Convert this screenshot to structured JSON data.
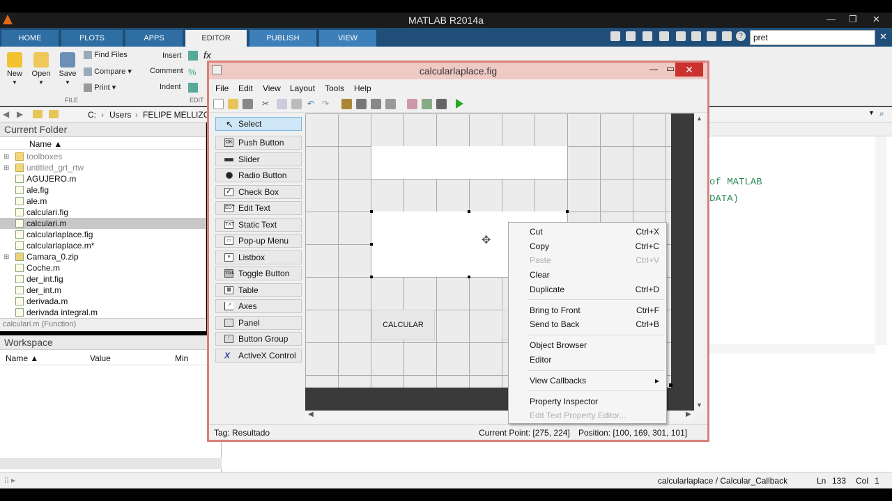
{
  "window": {
    "title": "MATLAB R2014a"
  },
  "ribbon_tabs": [
    {
      "label": "HOME"
    },
    {
      "label": "PLOTS"
    },
    {
      "label": "APPS"
    },
    {
      "label": "EDITOR"
    },
    {
      "label": "PUBLISH"
    },
    {
      "label": "VIEW"
    }
  ],
  "search": {
    "value": "pret"
  },
  "ribbon": {
    "new": "New",
    "open": "Open",
    "save": "Save",
    "find_files": "Find Files",
    "compare": "Compare",
    "print": "Print",
    "insert": "Insert",
    "comment": "Comment",
    "indent": "Indent",
    "file_group": "FILE",
    "edit_group": "EDIT"
  },
  "address": {
    "parts": [
      "C:",
      "Users",
      "FELIPE MELLIZO"
    ]
  },
  "current_folder": {
    "title": "Current Folder",
    "column": "Name",
    "items": [
      {
        "name": "toolboxes",
        "type": "folder"
      },
      {
        "name": "untitled_grt_rtw",
        "type": "folder"
      },
      {
        "name": "AGUJERO.m",
        "type": "m"
      },
      {
        "name": "ale.fig",
        "type": "fig"
      },
      {
        "name": "ale.m",
        "type": "m"
      },
      {
        "name": "calculari.fig",
        "type": "fig"
      },
      {
        "name": "calculari.m",
        "type": "m"
      },
      {
        "name": "calcularlaplace.fig",
        "type": "fig"
      },
      {
        "name": "calcularlaplace.m*",
        "type": "m"
      },
      {
        "name": "Camara_0.zip",
        "type": "zip"
      },
      {
        "name": "Coche.m",
        "type": "m"
      },
      {
        "name": "der_int.fig",
        "type": "fig"
      },
      {
        "name": "der_int.m",
        "type": "m"
      },
      {
        "name": "derivada.m",
        "type": "m"
      },
      {
        "name": "derivada integral.m",
        "type": "m"
      }
    ],
    "details": "calculari.m (Function)"
  },
  "workspace": {
    "title": "Workspace",
    "columns": [
      "Name",
      "Value",
      "Min"
    ]
  },
  "editor_bg": {
    "line1": "of MATLAB",
    "line2": "DATA)"
  },
  "guide": {
    "title": "calcularlaplace.fig",
    "menu": [
      "File",
      "Edit",
      "View",
      "Layout",
      "Tools",
      "Help"
    ],
    "palette": [
      "Select",
      "Push Button",
      "Slider",
      "Radio Button",
      "Check Box",
      "Edit Text",
      "Static Text",
      "Pop-up Menu",
      "Listbox",
      "Toggle Button",
      "Table",
      "Axes",
      "Panel",
      "Button Group",
      "ActiveX Control"
    ],
    "canvas_button": "CALCULAR",
    "status_tag": "Tag: Resultado",
    "current_point": "Current Point:  [275, 224]",
    "position": "Position: [100, 169, 301, 101]"
  },
  "context_menu": [
    {
      "label": "Cut",
      "shortcut": "Ctrl+X",
      "disabled": false
    },
    {
      "label": "Copy",
      "shortcut": "Ctrl+C",
      "disabled": false
    },
    {
      "label": "Paste",
      "shortcut": "Ctrl+V",
      "disabled": true
    },
    {
      "label": "Clear",
      "shortcut": "",
      "disabled": false
    },
    {
      "label": "Duplicate",
      "shortcut": "Ctrl+D",
      "disabled": false
    },
    {
      "label": "Bring to Front",
      "shortcut": "Ctrl+F",
      "disabled": false
    },
    {
      "label": "Send to Back",
      "shortcut": "Ctrl+B",
      "disabled": false
    },
    {
      "label": "Object Browser",
      "shortcut": "",
      "disabled": false
    },
    {
      "label": "Editor",
      "shortcut": "",
      "disabled": false
    },
    {
      "label": "View Callbacks",
      "shortcut": "▸",
      "disabled": false
    },
    {
      "label": "Property Inspector",
      "shortcut": "",
      "disabled": false
    },
    {
      "label": "Edit Text Property Editor...",
      "shortcut": "",
      "disabled": true
    }
  ],
  "status": {
    "callback": "calcularlaplace / Calcular_Callback",
    "ln_label": "Ln",
    "ln": "133",
    "col_label": "Col",
    "col": "1"
  },
  "colors": {
    "tab_bar": "#1f4e79",
    "guide_border": "#d8807a",
    "close": "#c9322d"
  }
}
